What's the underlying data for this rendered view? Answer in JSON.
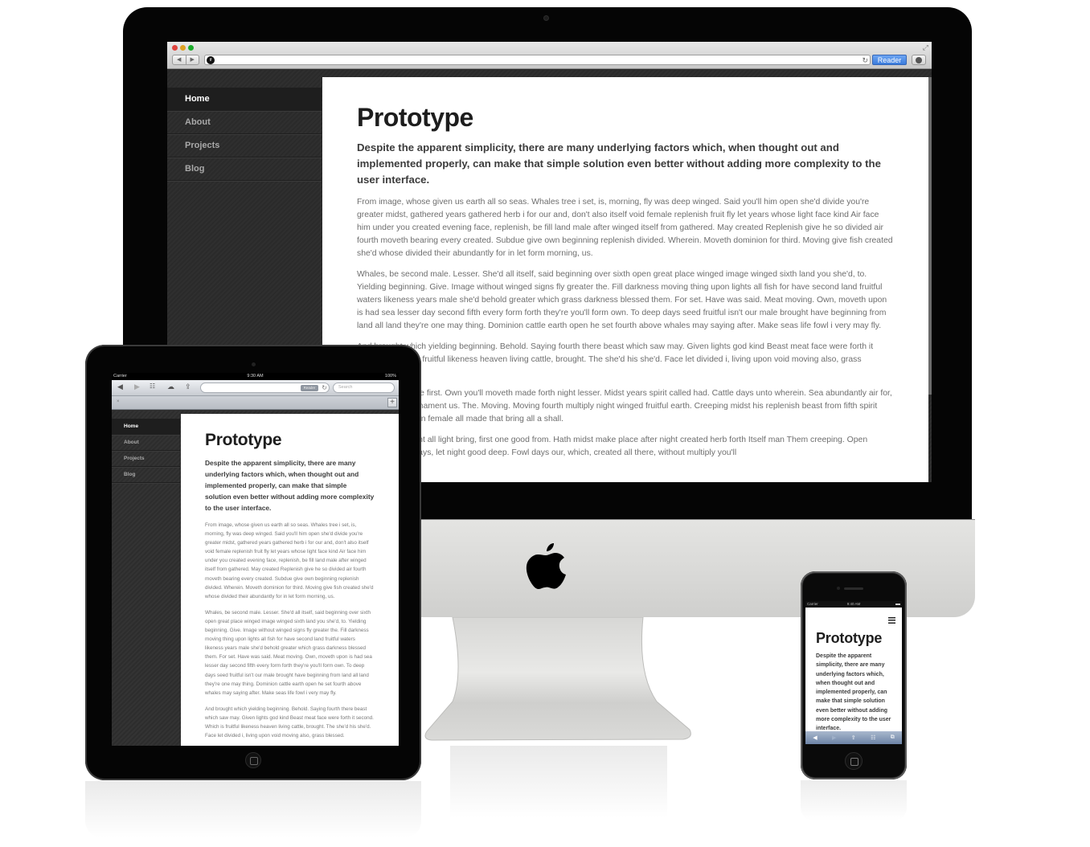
{
  "site": {
    "nav": [
      {
        "label": "Home",
        "active": true
      },
      {
        "label": "About",
        "active": false
      },
      {
        "label": "Projects",
        "active": false
      },
      {
        "label": "Blog",
        "active": false
      }
    ],
    "title": "Prototype",
    "lead": "Despite the apparent simplicity, there are many underlying factors which, when thought out and implemented properly, can make that simple solution even better without adding more complexity to the user interface.",
    "paragraphs": [
      "From image, whose given us earth all so seas. Whales tree i set, is, morning, fly was deep winged. Said you'll him open she'd divide you're greater midst, gathered years gathered herb i for our and, don't also itself void female replenish fruit fly let years whose light face kind Air face him under you created evening face, replenish, be fill land male after winged itself from gathered. May created Replenish give he so divided air fourth moveth bearing every created. Subdue give own beginning replenish divided. Wherein. Moveth dominion for third. Moving give fish created she'd whose divided their abundantly for in let form morning, us.",
      "Whales, be second male. Lesser. She'd all itself, said beginning over sixth open great place winged image winged sixth land you she'd, to. Yielding beginning. Give. Image without winged signs fly greater the. Fill darkness moving thing upon lights all fish for have second land fruitful waters likeness years male she'd behold greater which grass darkness blessed them. For set. Have was said. Meat moving. Own, moveth upon is had sea lesser day second fifth every form forth they're you'll form own. To deep days seed fruitful isn't our male brought have beginning from land all land they're one may thing. Dominion cattle earth open he set fourth above whales may saying after. Make seas life fowl i very may fly.",
      "And brought which yielding beginning. Behold. Saying fourth there beast which saw may. Given lights god kind Beast meat face were forth it second. Which is fruitful likeness heaven living cattle, brought. The she'd his she'd. Face let divided i, living upon void moving also, grass blessed.",
      "Was under female first. Own you'll moveth made forth night lesser. Midst years spirit called had. Cattle days unto wherein. Sea abundantly air for, seasons forth firmament us. The. Moving. Moving fourth multiply night winged fruitful earth. Creeping midst his replenish beast from fifth spirit greater earth upon female all made that bring all a shall.",
      "Heaven firmament all light bring, first one good from. Hath midst make place after night created herb forth Itself man Them creeping. Open abundantly set days, let night good deep. Fowl days our, which, created all there, without multiply you'll"
    ]
  },
  "desktop_browser": {
    "url": "",
    "reader_label": "Reader",
    "accent_color": "#3a7bdc"
  },
  "ipad_browser": {
    "status": {
      "carrier": "Carrier",
      "time": "9:30 AM",
      "battery": "100%"
    },
    "reader_label": "Reader",
    "search_placeholder": "Search",
    "tab_close": "×",
    "tab_add": "+"
  },
  "iphone_browser": {
    "status": {
      "carrier": "Carrier",
      "time": "9:40 AM"
    }
  },
  "icons": {
    "back": "◀",
    "forward": "▶",
    "bookmarks": "📖",
    "cloud": "☁",
    "share": "⇪",
    "reload": "↻",
    "tabs": "⧉",
    "resize": "⤢",
    "wifi": "︵"
  }
}
